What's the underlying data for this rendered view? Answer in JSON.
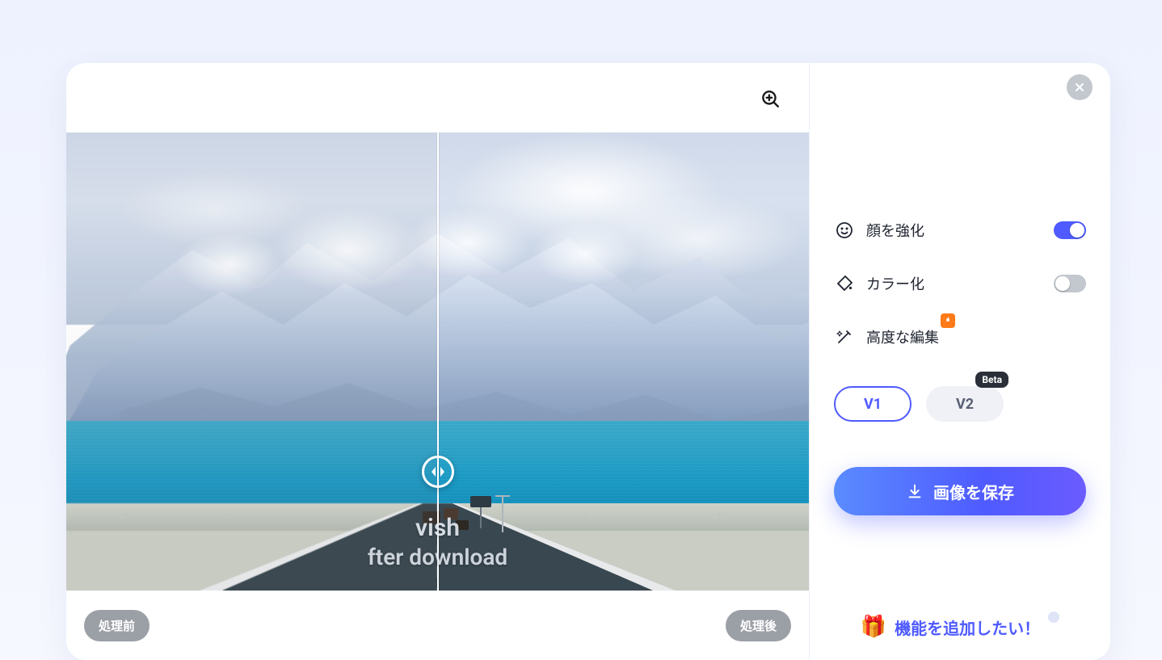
{
  "viewer": {
    "before_label": "処理前",
    "after_label": "処理後",
    "watermark_line1": "vish",
    "watermark_line2": "fter download"
  },
  "sidebar": {
    "face_enhance": {
      "label": "顔を強化",
      "enabled": true
    },
    "colorize": {
      "label": "カラー化",
      "enabled": false
    },
    "advanced_edit": {
      "label": "高度な編集"
    },
    "version": {
      "v1_label": "V1",
      "v2_label": "V2",
      "v2_badge": "Beta",
      "selected": "V1"
    },
    "save_button": "画像を保存",
    "feature_request": "機能を追加したい！"
  },
  "icons": {
    "zoom_in": "zoom-in-icon",
    "close": "close-icon",
    "face": "face-icon",
    "paint": "paint-bucket-icon",
    "wand": "magic-wand-icon",
    "fire": "fire-icon",
    "download": "download-icon",
    "slider": "slider-handle-icon",
    "gift": "gift-icon"
  },
  "colors": {
    "accent": "#4f5bff",
    "accent_gradient_start": "#5a8bff",
    "accent_gradient_end": "#6b5bff",
    "toggle_off": "#c3c7ce",
    "pill_bg": "#9b9fa6",
    "fire_badge": "#ff7a18"
  }
}
